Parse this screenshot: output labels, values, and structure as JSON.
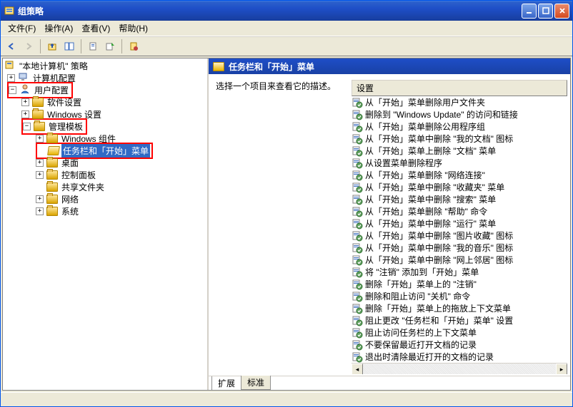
{
  "window": {
    "title": "组策略"
  },
  "menu": {
    "file": "文件(F)",
    "action": "操作(A)",
    "view": "查看(V)",
    "help": "帮助(H)"
  },
  "tree": {
    "root": "\"本地计算机\" 策略",
    "computer_cfg": "计算机配置",
    "user_cfg": "用户配置",
    "software_settings": "软件设置",
    "windows_settings": "Windows 设置",
    "admin_templates": "管理模板",
    "windows_components": "Windows 组件",
    "taskbar_start": "任务栏和「开始」菜单",
    "desktop": "桌面",
    "control_panel": "控制面板",
    "shared_folders": "共享文件夹",
    "network": "网络",
    "system": "系统"
  },
  "right": {
    "header": "任务栏和「开始」菜单",
    "prompt": "选择一个项目来查看它的描述。",
    "col_setting": "设置",
    "tabs": {
      "ext": "扩展",
      "std": "标准"
    },
    "settings": [
      "从「开始」菜单删除用户文件夹",
      "删除到 \"Windows Update\" 的访问和链接",
      "从「开始」菜单删除公用程序组",
      "从「开始」菜单中删除 \"我的文档\" 图标",
      "从「开始」菜单上删除 \"文档\" 菜单",
      "从设置菜单删除程序",
      "从「开始」菜单删除 \"网络连接\"",
      "从「开始」菜单中删除 \"收藏夹\" 菜单",
      "从「开始」菜单中删除 \"搜索\" 菜单",
      "从「开始」菜单删除 \"帮助\" 命令",
      "从「开始」菜单中删除 \"运行\" 菜单",
      "从「开始」菜单中删除 \"图片收藏\" 图标",
      "从「开始」菜单中删除 \"我的音乐\" 图标",
      "从「开始」菜单中删除 \"网上邻居\" 图标",
      "将 \"注销\" 添加到「开始」菜单",
      "删除「开始」菜单上的 \"注销\"",
      "删除和阻止访问 \"关机\" 命令",
      "删除「开始」菜单上的拖放上下文菜单",
      "阻止更改 \"任务栏和「开始」菜单\" 设置",
      "阻止访问任务栏的上下文菜单",
      "不要保留最近打开文档的记录",
      "退出时清除最近打开的文档的记录"
    ]
  }
}
